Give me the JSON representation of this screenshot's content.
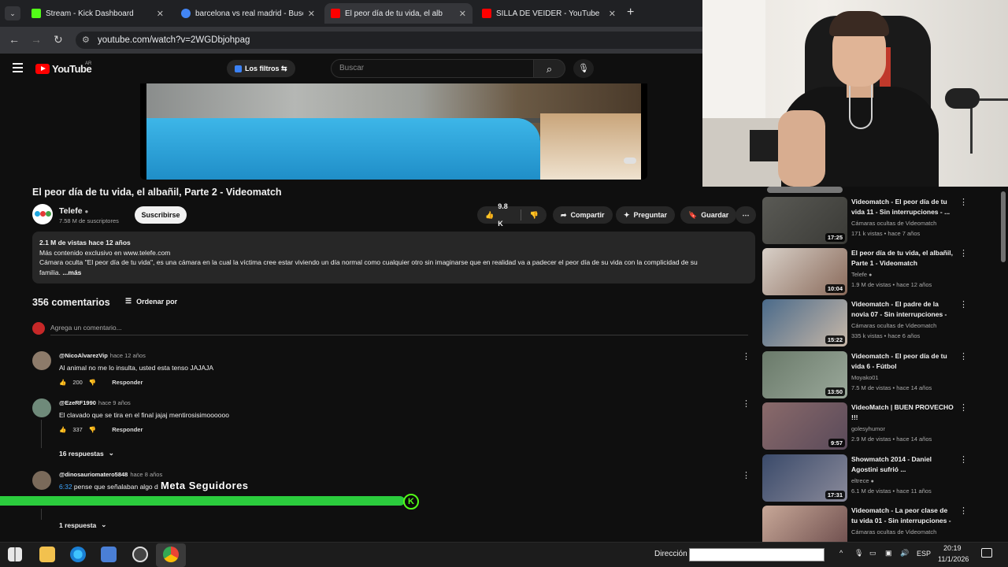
{
  "browser": {
    "tabs": [
      {
        "title": "Stream - Kick Dashboard",
        "favicon_color": "#53fc18",
        "active": false
      },
      {
        "title": "barcelona vs real madrid - Busc",
        "favicon_color": "#4285f4",
        "active": false
      },
      {
        "title": "El peor día de tu vida, el alb",
        "favicon_color": "#ff0000",
        "active": true
      },
      {
        "title": "SILLA DE VEIDER - YouTube",
        "favicon_color": "#ff0000",
        "active": false
      }
    ],
    "url": "youtube.com/watch?v=2WGDbjohpag",
    "new_tab_label": "+"
  },
  "youtube": {
    "logo_text": "YouTube",
    "region": "AR",
    "filters_label": "Los filtros",
    "search_placeholder": "Buscar"
  },
  "video": {
    "title": "El peor día de tu vida, el albañil, Parte 2 - Videomatch",
    "channel": "Telefe",
    "subscribers": "7.58 M de suscriptores",
    "subscribe_label": "Suscribirse",
    "likes": "9.8 K",
    "share_label": "Compartir",
    "ask_label": "Preguntar",
    "save_label": "Guardar",
    "description": {
      "stats": "2.1 M de vistas  hace 12 años",
      "line1": "Más contenido exclusivo en www.telefe.com",
      "line2": "Cámara oculta \"El peor día de tu vida\", es una cámara en la cual la víctima cree estar viviendo un día normal como cualquier otro sin imaginarse que en realidad va a padecer el peor día de su vida con la complicidad de su",
      "line3": "familia.",
      "more": "...más"
    }
  },
  "comments": {
    "count_label": "356 comentarios",
    "sort_label": "Ordenar por",
    "add_placeholder": "Agrega un comentario...",
    "items": [
      {
        "author": "@NicoAlvarezVip",
        "time": "hace 12 años",
        "text": "Al animal no me lo insulta, usted esta tenso JAJAJA",
        "likes": "200",
        "reply_label": "Responder"
      },
      {
        "author": "@EzeRF1990",
        "time": "hace 9 años",
        "text": "El clavado que se tira en el final jajaj mentirosisimoooooo",
        "likes": "337",
        "reply_label": "Responder",
        "replies": "16 respuestas"
      },
      {
        "author": "@dinosauriomatero5848",
        "time": "hace 8 años",
        "timestamp_link": "6:32",
        "text": "pense que señalaban algo d",
        "replies": "1 respuesta"
      }
    ]
  },
  "overlay": {
    "goal_label": "Meta Seguidores",
    "goal_progress": 0.97,
    "goal_icon": "K",
    "goal_color": "#53fc18"
  },
  "sidebar": {
    "items": [
      {
        "title": "Videomatch - El peor día de tu vida 11 - Sin interrupciones - ...",
        "channel": "Cámaras ocultas de Videomatch",
        "meta": "171 k vistas • hace 7 años",
        "duration": "17:25"
      },
      {
        "title": "El peor día de tu vida, el albañil, Parte 1 - Videomatch",
        "channel": "Telefe",
        "meta": "1.9 M de vistas • hace 12 años",
        "duration": "10:04"
      },
      {
        "title": "Videomatch - El padre de la novia 07 - Sin interrupciones - ...",
        "channel": "Cámaras ocultas de Videomatch",
        "meta": "335 k vistas • hace 6 años",
        "duration": "15:22"
      },
      {
        "title": "Videomatch - El peor día de tu vida 6 - Fútbol",
        "channel": "Moyako01",
        "meta": "7.5 M de vistas • hace 14 años",
        "duration": "13:50"
      },
      {
        "title": "VideoMatch | BUEN PROVECHO !!!",
        "channel": "golesyhumor",
        "meta": "2.9 M de vistas • hace 14 años",
        "duration": "9:57"
      },
      {
        "title": "Showmatch 2014 - Daniel Agostini sufrió ...",
        "channel": "eltrece",
        "meta": "6.1 M de vistas • hace 11 años",
        "duration": "17:31"
      },
      {
        "title": "Videomatch - La peor clase de tu vida 01 - Sin interrupciones - ...",
        "channel": "Cámaras ocultas de Videomatch",
        "meta": "",
        "duration": ""
      }
    ]
  },
  "taskbar": {
    "address_label": "Dirección",
    "language": "ESP",
    "time": "20:19",
    "date": "11/1/2026"
  }
}
